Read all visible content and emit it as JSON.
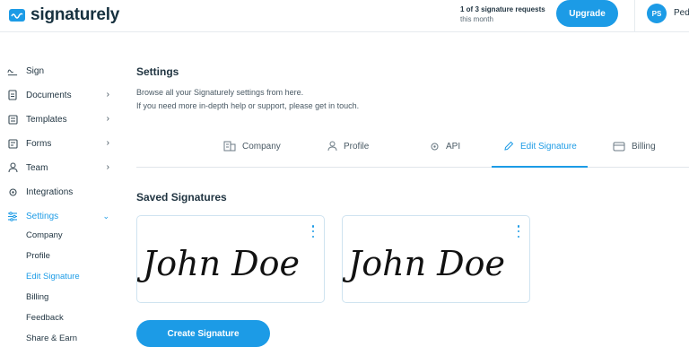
{
  "header": {
    "logo_text": "signaturely",
    "quota_line1": "1 of 3 signature requests",
    "quota_line2": "this month",
    "upgrade_label": "Upgrade",
    "avatar_initials": "PS",
    "user_name": "Pedro"
  },
  "sidebar": {
    "items": [
      {
        "label": "Sign",
        "icon": "sign-icon"
      },
      {
        "label": "Documents",
        "icon": "document-icon"
      },
      {
        "label": "Templates",
        "icon": "template-icon"
      },
      {
        "label": "Forms",
        "icon": "forms-icon"
      },
      {
        "label": "Team",
        "icon": "team-icon"
      },
      {
        "label": "Integrations",
        "icon": "gear-icon"
      },
      {
        "label": "Settings",
        "icon": "sliders-icon"
      }
    ],
    "settings_subitems": [
      "Company",
      "Profile",
      "Edit Signature",
      "Billing",
      "Feedback",
      "Share & Earn"
    ]
  },
  "main": {
    "title": "Settings",
    "desc_line1": "Browse all your Signaturely settings from here.",
    "desc_line2": "If you need more in-depth help or support, please get in touch.",
    "tabs": [
      {
        "label": "Company",
        "icon": "building-icon"
      },
      {
        "label": "Profile",
        "icon": "user-icon"
      },
      {
        "label": "API",
        "icon": "gear-icon"
      },
      {
        "label": "Edit Signature",
        "icon": "pen-icon"
      },
      {
        "label": "Billing",
        "icon": "card-icon"
      }
    ],
    "active_tab": "Edit Signature",
    "saved_title": "Saved Signatures",
    "signatures": [
      "John Doe",
      "John Doe"
    ],
    "create_label": "Create Signature"
  },
  "colors": {
    "accent": "#1c9be6",
    "text": "#1f3340",
    "border": "#cfe3f0"
  }
}
